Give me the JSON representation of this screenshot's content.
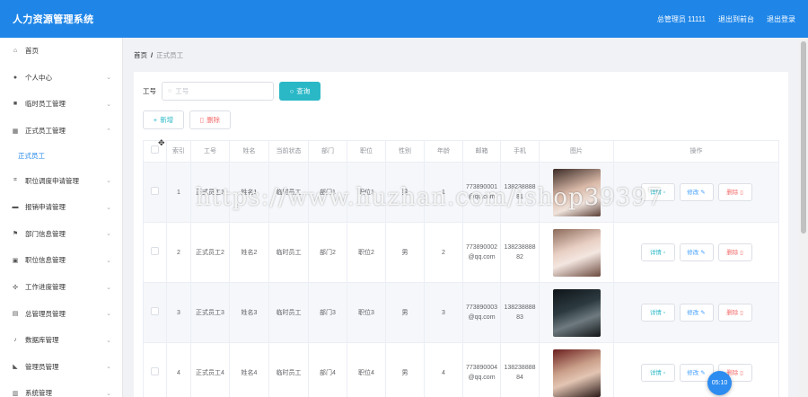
{
  "header": {
    "title": "人力资源管理系统",
    "user": "总管理员 11111",
    "back_to_front": "退出到前台",
    "logout": "退出登录"
  },
  "sidebar": {
    "items": [
      {
        "label": "首页",
        "icon": "home-icon",
        "expandable": false
      },
      {
        "label": "个人中心",
        "icon": "user-icon",
        "expandable": true
      },
      {
        "label": "临时员工管理",
        "icon": "briefcase-icon",
        "expandable": true
      },
      {
        "label": "正式员工管理",
        "icon": "building-icon",
        "expandable": true,
        "expanded": true
      },
      {
        "label": "职位调度申请管理",
        "icon": "crop-icon",
        "expandable": true
      },
      {
        "label": "报销申请管理",
        "icon": "chat-icon",
        "expandable": true
      },
      {
        "label": "部门信息管理",
        "icon": "flag-icon",
        "expandable": true
      },
      {
        "label": "职位信息管理",
        "icon": "comment-icon",
        "expandable": true
      },
      {
        "label": "工作进度管理",
        "icon": "tools-icon",
        "expandable": true
      },
      {
        "label": "总管理员管理",
        "icon": "grid-icon",
        "expandable": true
      },
      {
        "label": "数据库管理",
        "icon": "mic-icon",
        "expandable": true
      },
      {
        "label": "管理员管理",
        "icon": "thumb-icon",
        "expandable": true
      },
      {
        "label": "系统管理",
        "icon": "system-icon",
        "expandable": true
      }
    ],
    "active_sub": "正式员工"
  },
  "breadcrumb": {
    "home": "首页",
    "sep": "/",
    "current": "正式员工"
  },
  "search": {
    "label": "工号",
    "placeholder": "工号",
    "button": "查询"
  },
  "toolbar": {
    "add": "新增",
    "delete": "删除"
  },
  "table": {
    "columns": [
      "索引",
      "工号",
      "姓名",
      "当前状态",
      "部门",
      "职位",
      "性别",
      "年龄",
      "邮箱",
      "手机",
      "图片",
      "操作"
    ],
    "rows": [
      {
        "index": "1",
        "job_no": "正式员工1",
        "name": "姓名1",
        "status": "临时员工",
        "dept": "部门1",
        "position": "职位1",
        "gender": "男",
        "age": "1",
        "email": "773890001@qq.com",
        "phone": "13823888881",
        "photo": "portrait-woman-1"
      },
      {
        "index": "2",
        "job_no": "正式员工2",
        "name": "姓名2",
        "status": "临时员工",
        "dept": "部门2",
        "position": "职位2",
        "gender": "男",
        "age": "2",
        "email": "773890002@qq.com",
        "phone": "13823888882",
        "photo": "portrait-woman-2"
      },
      {
        "index": "3",
        "job_no": "正式员工3",
        "name": "姓名3",
        "status": "临时员工",
        "dept": "部门3",
        "position": "职位3",
        "gender": "男",
        "age": "3",
        "email": "773890003@qq.com",
        "phone": "13823888883",
        "photo": "portrait-man-1"
      },
      {
        "index": "4",
        "job_no": "正式员工4",
        "name": "姓名4",
        "status": "临时员工",
        "dept": "部门4",
        "position": "职位4",
        "gender": "男",
        "age": "4",
        "email": "773890004@qq.com",
        "phone": "13823888884",
        "photo": "portrait-man-2"
      }
    ],
    "ops": {
      "detail": "详情",
      "edit": "修改",
      "remove": "删除"
    }
  },
  "timer": "05:10",
  "watermark": "https://www.huzhan.com/ishop39397",
  "colors": {
    "header": "#1f86e8",
    "query": "#2ab8c7",
    "danger": "#f56c6c",
    "primary": "#409eff"
  }
}
